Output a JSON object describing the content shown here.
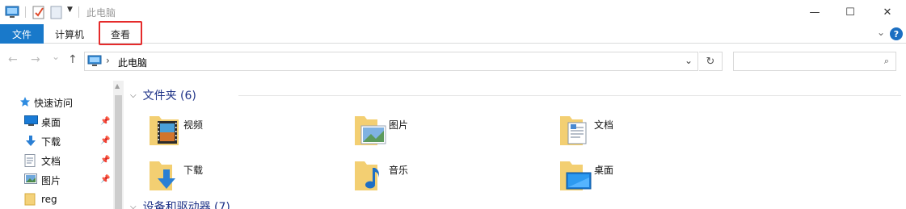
{
  "window": {
    "title": "此电脑",
    "minimize_glyph": "—",
    "maximize_glyph": "☐",
    "close_glyph": "✕"
  },
  "quick_access_toolbar": {
    "icons": [
      "computer-icon",
      "properties-icon",
      "new-folder-icon",
      "customize-dropdown-icon"
    ]
  },
  "ribbon": {
    "tabs": [
      {
        "label": "文件"
      },
      {
        "label": "计算机"
      },
      {
        "label": "查看"
      }
    ],
    "help_label": "?",
    "highlight_color": "#e52b2b",
    "file_tab_color": "#1979ca"
  },
  "address_bar": {
    "back_glyph": "←",
    "forward_glyph": "→",
    "recent_glyph": "⌄",
    "up_glyph": "↑",
    "separator": "›",
    "path": "此电脑",
    "search_placeholder": ""
  },
  "sidebar": {
    "items": [
      {
        "label": "快速访问",
        "icon": "star-icon",
        "pinned": false
      },
      {
        "label": "桌面",
        "icon": "desktop-icon",
        "pinned": true
      },
      {
        "label": "下载",
        "icon": "download-icon",
        "pinned": true
      },
      {
        "label": "文档",
        "icon": "document-icon",
        "pinned": true
      },
      {
        "label": "图片",
        "icon": "picture-icon",
        "pinned": true
      },
      {
        "label": "reg",
        "icon": "folder-icon",
        "pinned": false
      }
    ]
  },
  "content": {
    "groups": [
      {
        "header": "文件夹 (6)",
        "items": [
          {
            "label": "视频",
            "icon": "videos-folder-icon"
          },
          {
            "label": "图片",
            "icon": "pictures-folder-icon"
          },
          {
            "label": "文档",
            "icon": "documents-folder-icon"
          },
          {
            "label": "下载",
            "icon": "downloads-folder-icon"
          },
          {
            "label": "音乐",
            "icon": "music-folder-icon"
          },
          {
            "label": "桌面",
            "icon": "desktop-folder-icon"
          }
        ]
      },
      {
        "header": "设备和驱动器 (7)",
        "items": []
      }
    ],
    "header_color": "#1e3287"
  }
}
